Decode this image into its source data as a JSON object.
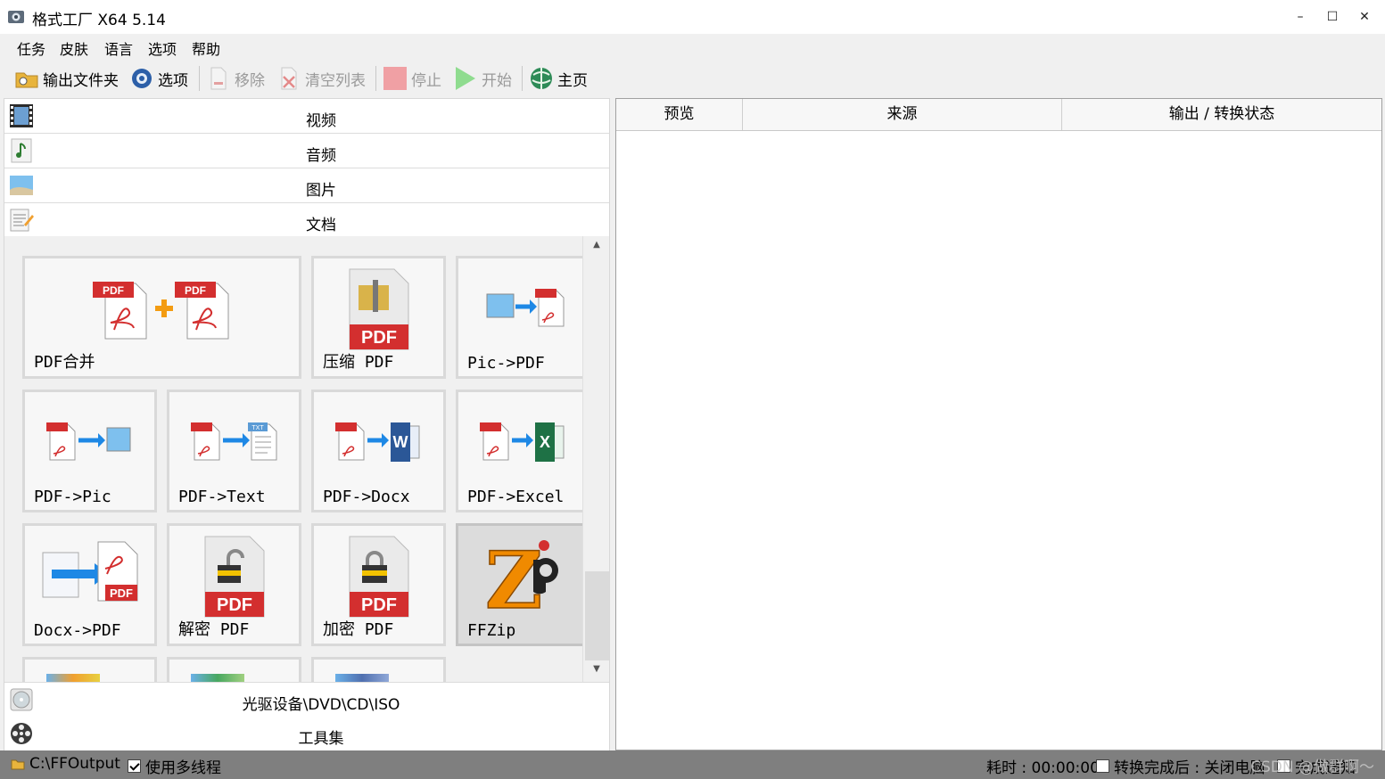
{
  "window": {
    "title": "格式工厂 X64 5.14",
    "minimize": "–",
    "maximize": "☐",
    "close": "✕"
  },
  "menu": [
    "任务",
    "皮肤",
    "语言",
    "选项",
    "帮助"
  ],
  "toolbar": {
    "output_folder": "输出文件夹",
    "options": "选项",
    "remove": "移除",
    "clear_list": "清空列表",
    "stop": "停止",
    "start": "开始",
    "home": "主页"
  },
  "categories": {
    "video": "视频",
    "audio": "音频",
    "picture": "图片",
    "document": "文档",
    "rom": "光驱设备\\DVD\\CD\\ISO",
    "tools": "工具集"
  },
  "tiles": {
    "pdf_merge": "PDF合并",
    "compress_pdf": "压缩 PDF",
    "pic_to_pdf": "Pic->PDF",
    "pdf_to_pic": "PDF->Pic",
    "pdf_to_text": "PDF->Text",
    "pdf_to_docx": "PDF->Docx",
    "pdf_to_excel": "PDF->Excel",
    "docx_to_pdf": "Docx->PDF",
    "decrypt_pdf": "解密 PDF",
    "encrypt_pdf": "加密 PDF",
    "ffzip": "FFZip"
  },
  "badges": {
    "pdf": "PDF",
    "txt": "TXT",
    "word": "W",
    "excel": "X",
    "zip": "Z"
  },
  "list_columns": [
    "预览",
    "来源",
    "输出 / 转换状态"
  ],
  "status": {
    "output_path": "C:\\FFOutput",
    "multithread_label": "使用多线程",
    "multithread_checked": true,
    "elapsed_label": "耗时 : 00:00:00",
    "after_done_label": "转换完成后 : 关闭电脑",
    "after_done_checked": false,
    "notify_label": "完成通知",
    "watermark": "CSDN @做群啊～"
  },
  "colors": {
    "pdf_red": "#d32f2f",
    "accent_blue": "#1e88e5",
    "status_bg": "#7f7f7f"
  }
}
